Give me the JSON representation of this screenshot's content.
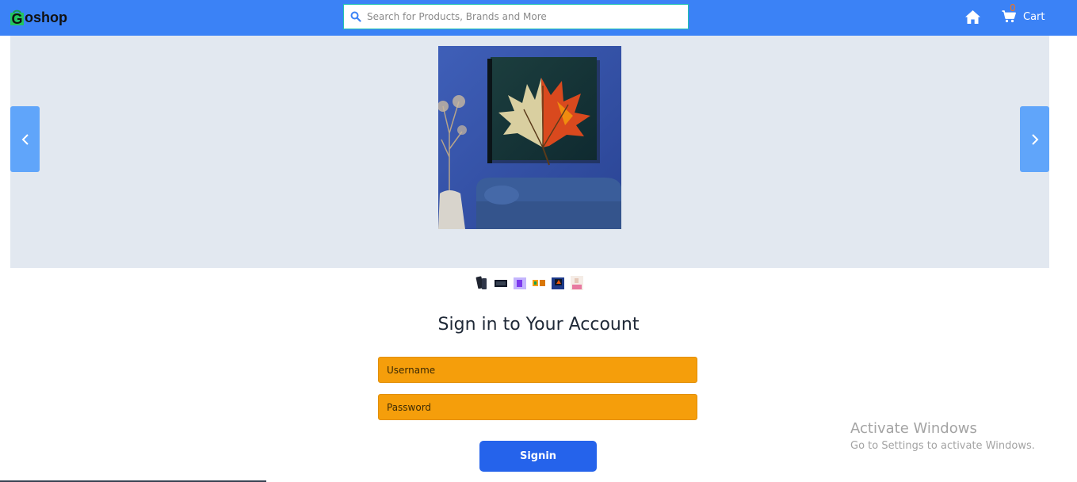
{
  "header": {
    "logo_text": "oshop",
    "logo_letter": "G",
    "search_placeholder": "Search for Products, Brands and More",
    "cart_count": "0",
    "cart_label": "Cart"
  },
  "icons": {
    "logo": "shopping-bag-icon",
    "search": "search-icon",
    "home": "home-icon",
    "cart": "shopping-cart-icon",
    "prev": "chevron-left-icon",
    "next": "chevron-right-icon"
  },
  "carousel": {
    "slide_count": 6,
    "active_slide": 6
  },
  "signin": {
    "title": "Sign in to Your Account",
    "username_placeholder": "Username",
    "password_placeholder": "Password",
    "button_label": "Signin"
  },
  "watermark": {
    "title": "Activate Windows",
    "subtitle": "Go to Settings to activate Windows."
  },
  "colors": {
    "navbar": "#3b82f6",
    "carousel_bg": "#e2e8f0",
    "carousel_button": "#60a5fa",
    "input_bg": "#f59e0b",
    "signin_button": "#2563eb",
    "cart_badge": "#f97316"
  }
}
